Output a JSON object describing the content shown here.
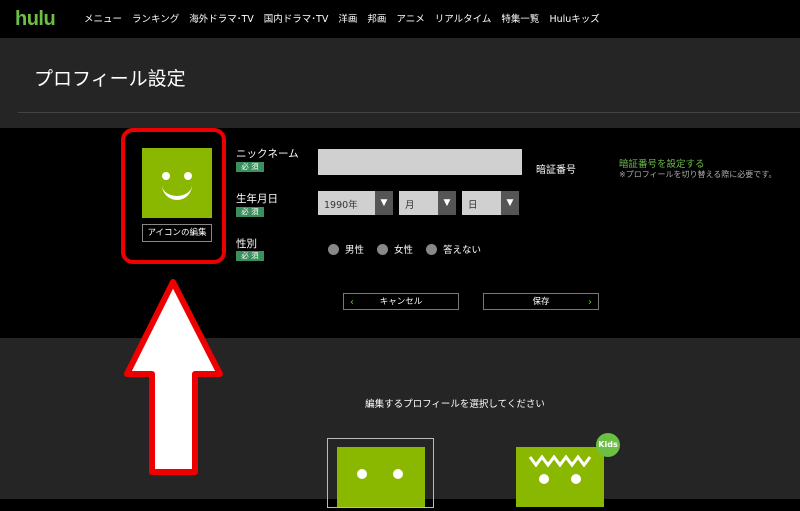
{
  "nav": {
    "logo": "hulu",
    "items": [
      "メニュー",
      "ランキング",
      "海外ドラマ･TV",
      "国内ドラマ･TV",
      "洋画",
      "邦画",
      "アニメ",
      "リアルタイム",
      "特集一覧",
      "Huluキッズ"
    ]
  },
  "page": {
    "title": "プロフィール設定"
  },
  "profile_form": {
    "icon_edit_label": "アイコンの編集",
    "nickname_label": "ニックネーム",
    "required_badge": "必 須",
    "nickname_value": "",
    "birthdate_label": "生年月日",
    "year_value": "1990年",
    "month_value": "月",
    "day_value": "日",
    "gender_label": "性別",
    "gender_options": [
      "男性",
      "女性",
      "答えない"
    ],
    "pin_label": "暗証番号",
    "pin_link": "暗証番号を設定する",
    "pin_note": "※プロフィールを切り替える際に必要です。",
    "cancel_label": "キャンセル",
    "save_label": "保存"
  },
  "profile_select": {
    "message": "編集するプロフィールを選択してください",
    "kids_badge": "Kids"
  },
  "colors": {
    "brand_green": "#6dbe45",
    "avatar_green": "#8ab800",
    "highlight_red": "#e00000",
    "badge_green": "#3a8f5c"
  },
  "icons": [
    "smiley-avatar-icon",
    "chevron-down-icon",
    "chevron-left-icon",
    "chevron-right-icon",
    "kids-profile-icon",
    "up-arrow-annotation"
  ]
}
